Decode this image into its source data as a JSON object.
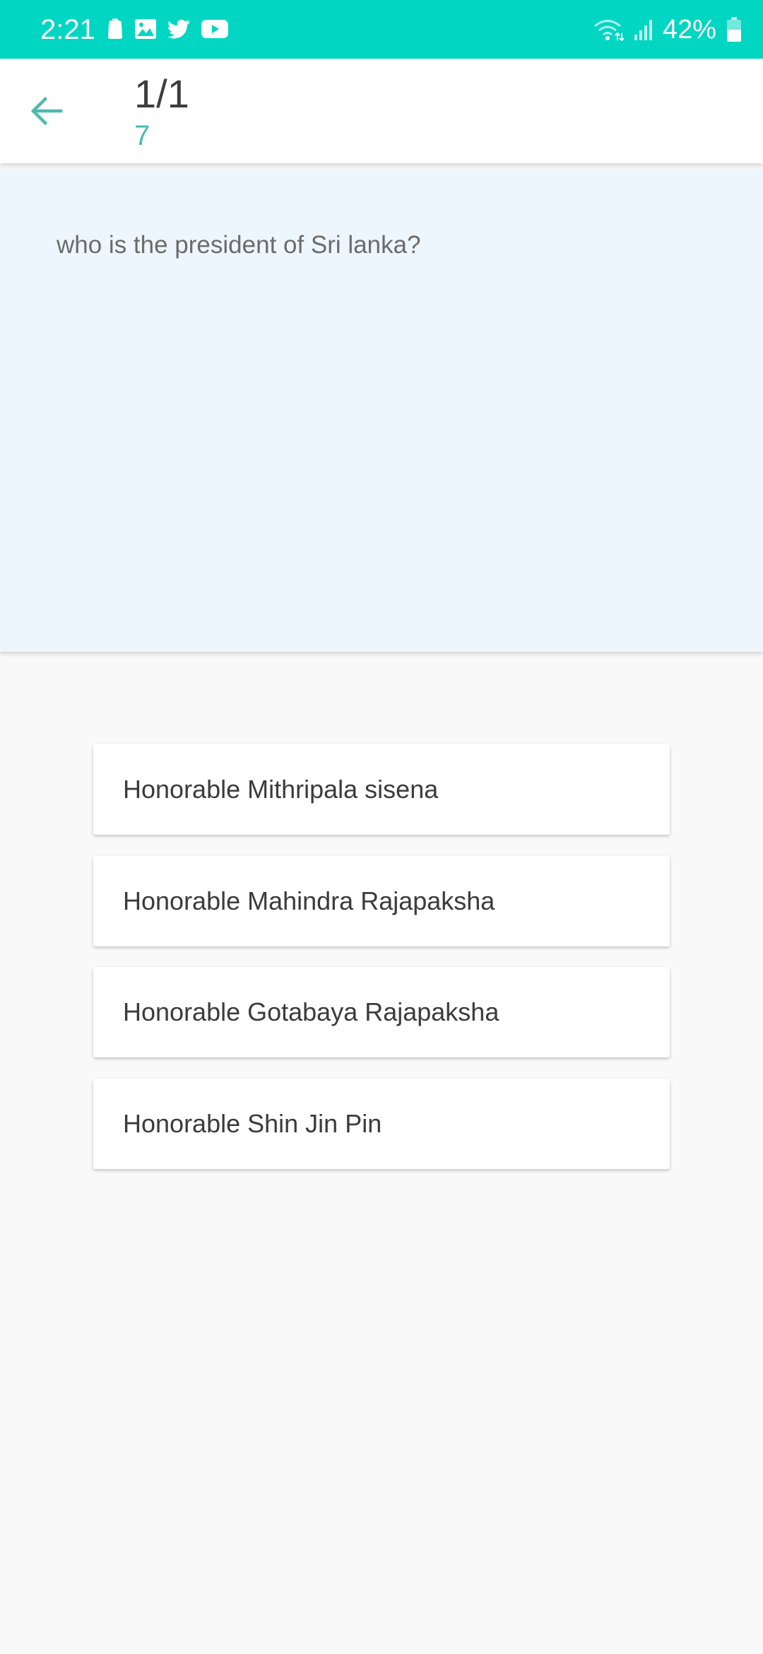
{
  "status_bar": {
    "time": "2:21",
    "battery_percent": "42%",
    "icons_left": [
      "notification-icon",
      "gallery-icon",
      "twitter-icon",
      "youtube-icon"
    ],
    "icons_right": [
      "wifi-icon",
      "signal-icon",
      "battery-icon"
    ],
    "background_color": "#00d6c2"
  },
  "app_bar": {
    "title": "1/1",
    "subtitle": "7",
    "back_icon": "arrow-left-icon",
    "accent_color": "#4dbab0"
  },
  "question": {
    "text": "who is the president of Sri lanka?",
    "card_color": "#eef6fd"
  },
  "answers": [
    {
      "label": "Honorable Mithripala sisena"
    },
    {
      "label": "Honorable Mahindra Rajapaksha"
    },
    {
      "label": "Honorable Gotabaya Rajapaksha"
    },
    {
      "label": "Honorable Shin Jin Pin"
    }
  ]
}
